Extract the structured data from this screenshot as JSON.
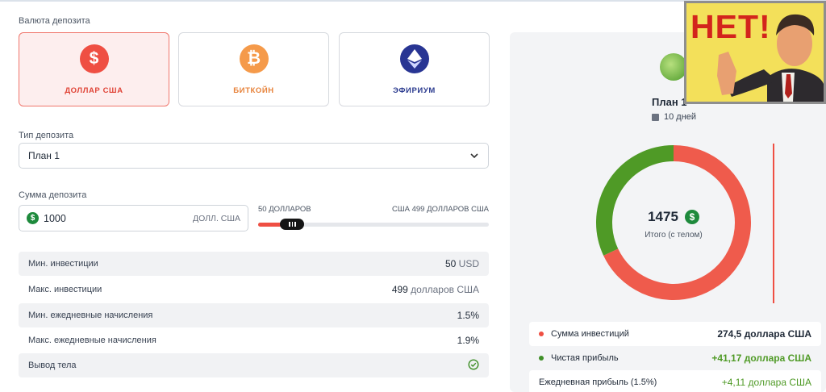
{
  "currency": {
    "label": "Валюта депозита",
    "options": [
      {
        "name": "ДОЛЛАР США",
        "symbol": "$",
        "color": "#ef4f43",
        "text_color": "#e04437",
        "active": true
      },
      {
        "name": "БИТКОЙН",
        "symbol": "₿",
        "color": "#f59a4a",
        "text_color": "#e7823a",
        "active": false
      },
      {
        "name": "ЭФИРИУМ",
        "symbol": "◆",
        "color": "#283593",
        "text_color": "#2b3b8f",
        "active": false
      }
    ]
  },
  "deposit_type": {
    "label": "Тип депозита",
    "value": "План 1"
  },
  "amount": {
    "label": "Сумма депозита",
    "value": "1000",
    "unit": "ДОЛЛ. США",
    "min_label": "50 ДОЛЛАРОВ",
    "max_label": "США 499 ДОЛЛАРОВ США",
    "slider_fraction": 0.12
  },
  "info_rows": [
    {
      "key": "Мин. инвестиции",
      "num": "50",
      "suffix": " USD"
    },
    {
      "key": "Макс. инвестиции",
      "num": "499",
      "suffix": " долларов США"
    },
    {
      "key": "Мин. ежедневные начисления",
      "num": "1.5%",
      "suffix": ""
    },
    {
      "key": "Макс. ежедневные начисления",
      "num": "1.9%",
      "suffix": ""
    },
    {
      "key": "Вывод тела",
      "num": "",
      "suffix": "",
      "check": true
    }
  ],
  "summary": {
    "plan_title": "План 1",
    "duration": "10 дней",
    "total": "1475",
    "total_label": "Итого (с телом)",
    "donut": [
      {
        "label": "Сумма инвестиций",
        "fraction": 0.68,
        "color": "#ef5b4c"
      },
      {
        "label": "Чистая прибыль",
        "fraction": 0.32,
        "color": "#4f9a26"
      }
    ],
    "rows": [
      {
        "label": "Сумма инвестиций",
        "value": "274,5 доллара США",
        "dot": "#ef4f43",
        "value_color": "#1f2937"
      },
      {
        "label": "Чистая прибыль",
        "value": "+41,17 доллара США",
        "dot": "#3f8f28",
        "value_color": "#4f9a26"
      },
      {
        "label": "Ежедневная прибыль (1.5%)",
        "value": "+4,11 доллара США",
        "dot": "",
        "value_color": "#4f9a26"
      }
    ]
  },
  "meme": {
    "text": "НЕТ!"
  }
}
